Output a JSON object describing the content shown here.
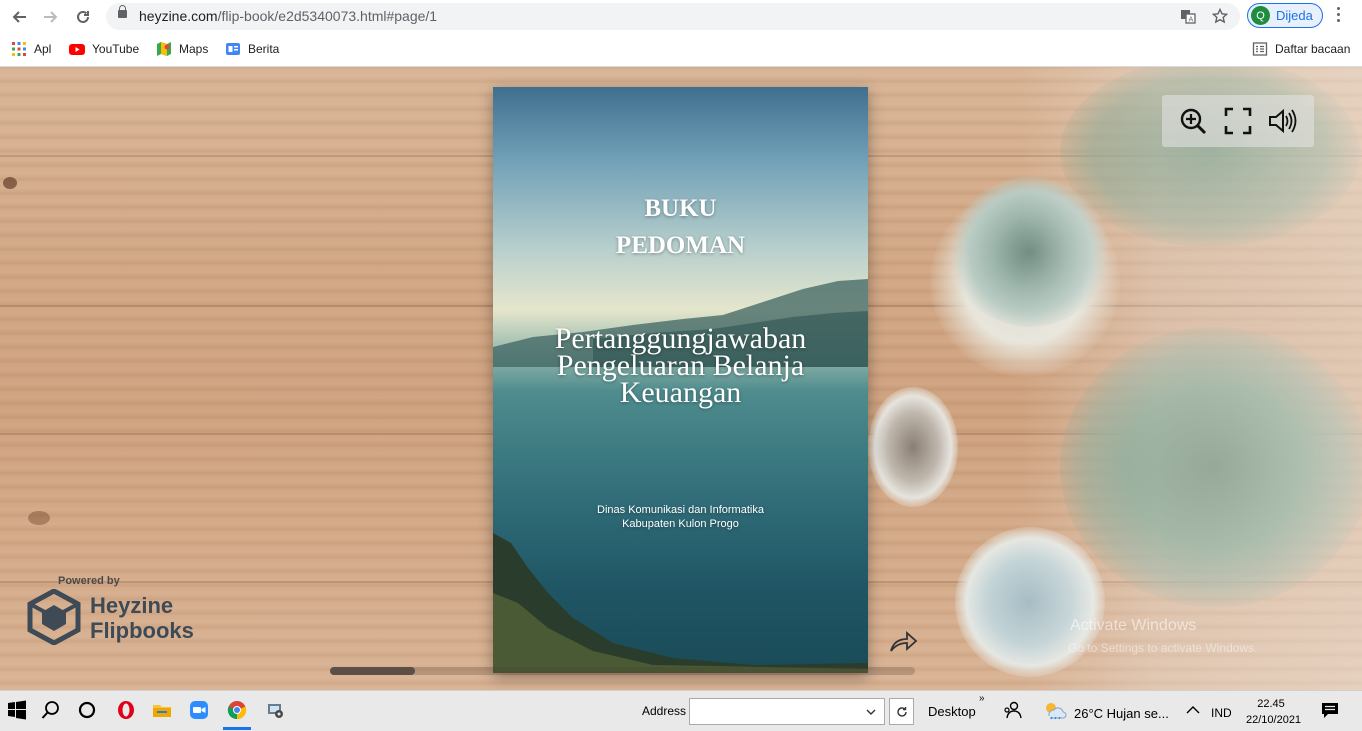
{
  "browser": {
    "url_host": "heyzine.com",
    "url_path": "/flip-book/e2d5340073.html#page/1",
    "profile_initial": "Q",
    "profile_label": "Dijeda",
    "bookmarks": [
      {
        "label": "Apl",
        "icon": "apps-grid-icon"
      },
      {
        "label": "YouTube",
        "icon": "youtube-icon"
      },
      {
        "label": "Maps",
        "icon": "maps-icon"
      },
      {
        "label": "Berita",
        "icon": "news-icon"
      }
    ],
    "reading_list": "Daftar bacaan"
  },
  "book": {
    "title_line1": "BUKU",
    "title_line2": "PEDOMAN",
    "subtitle_line1": "Pertanggungjawaban",
    "subtitle_line2": "Pengeluaran Belanja",
    "subtitle_line3": "Keuangan",
    "publisher_line1": "Dinas Komunikasi dan Informatika",
    "publisher_line2": "Kabupaten Kulon Progo"
  },
  "branding": {
    "powered_by": "Powered by",
    "brand_line1": "Heyzine",
    "brand_line2": "Flipbooks"
  },
  "watermark": {
    "line1": "Activate Windows",
    "line2": "Go to Settings to activate Windows."
  },
  "taskbar": {
    "address_label": "Address",
    "address_value": "",
    "desktop_label": "Desktop",
    "weather": "26°C  Hujan se...",
    "language": "IND",
    "time": "22.45",
    "date": "22/10/2021"
  },
  "colors": {
    "accent": "#1a73e8",
    "profile_avatar": "#1e8e3e",
    "brand_text": "#3e4a55"
  }
}
